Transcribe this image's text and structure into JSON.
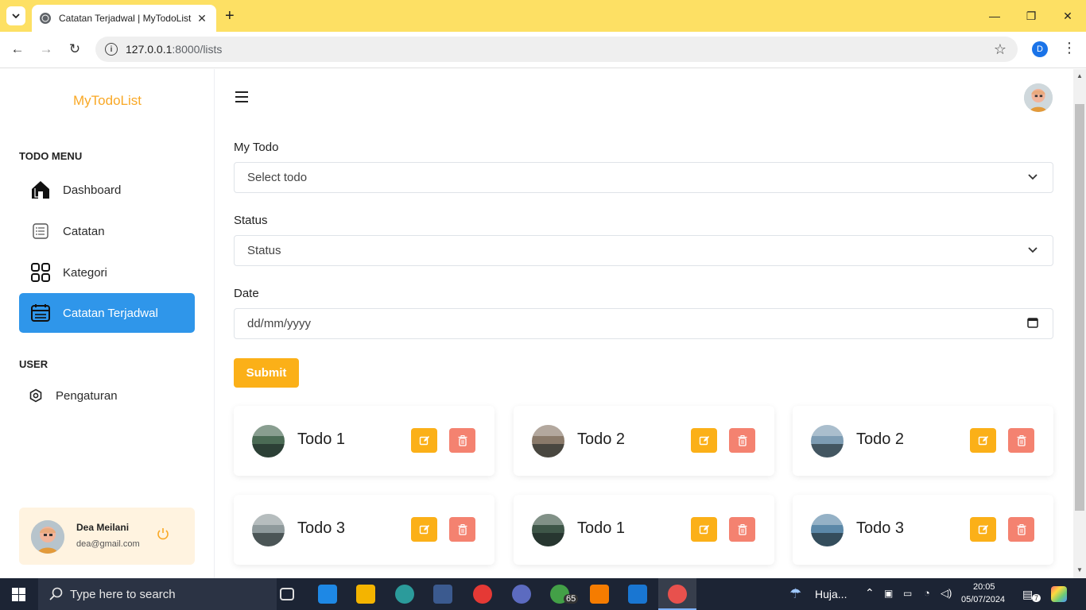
{
  "browser": {
    "tab_title": "Catatan Terjadwal | MyTodoList",
    "url_host": "127.0.0.1",
    "url_rest": ":8000/lists",
    "profile_initial": "D"
  },
  "sidebar": {
    "brand": "MyTodoList",
    "todo_menu_title": "TODO MENU",
    "items": [
      {
        "label": "Dashboard",
        "icon": "home-icon"
      },
      {
        "label": "Catatan",
        "icon": "notes-icon"
      },
      {
        "label": "Kategori",
        "icon": "category-icon"
      },
      {
        "label": "Catatan Terjadwal",
        "icon": "calendar-notes-icon",
        "active": true
      }
    ],
    "user_title": "USER",
    "settings_label": "Pengaturan",
    "user": {
      "name": "Dea Meilani",
      "email": "dea@gmail.com"
    }
  },
  "form": {
    "todo_label": "My Todo",
    "todo_placeholder": "Select todo",
    "status_label": "Status",
    "status_placeholder": "Status",
    "date_label": "Date",
    "date_placeholder": "dd/mm/yyyy",
    "submit_label": "Submit"
  },
  "todos": [
    {
      "title": "Todo 1",
      "thumb_color": "#4b6b55"
    },
    {
      "title": "Todo 2",
      "thumb_color": "#8a7a6a"
    },
    {
      "title": "Todo 2",
      "thumb_color": "#7d9cb3"
    },
    {
      "title": "Todo 3",
      "thumb_color": "#8f9a9c"
    },
    {
      "title": "Todo 1",
      "thumb_color": "#3e5648"
    },
    {
      "title": "Todo 3",
      "thumb_color": "#5b88a8"
    }
  ],
  "taskbar": {
    "search_placeholder": "Type here to search",
    "weather": "Huja...",
    "time": "20:05",
    "date": "05/07/2024",
    "whatsapp_badge": "65",
    "notification_count": "7"
  },
  "colors": {
    "accent_orange": "#fbb018",
    "active_blue": "#2f96ea",
    "delete_red": "#f48270",
    "tabbar_yellow": "#fde064"
  }
}
